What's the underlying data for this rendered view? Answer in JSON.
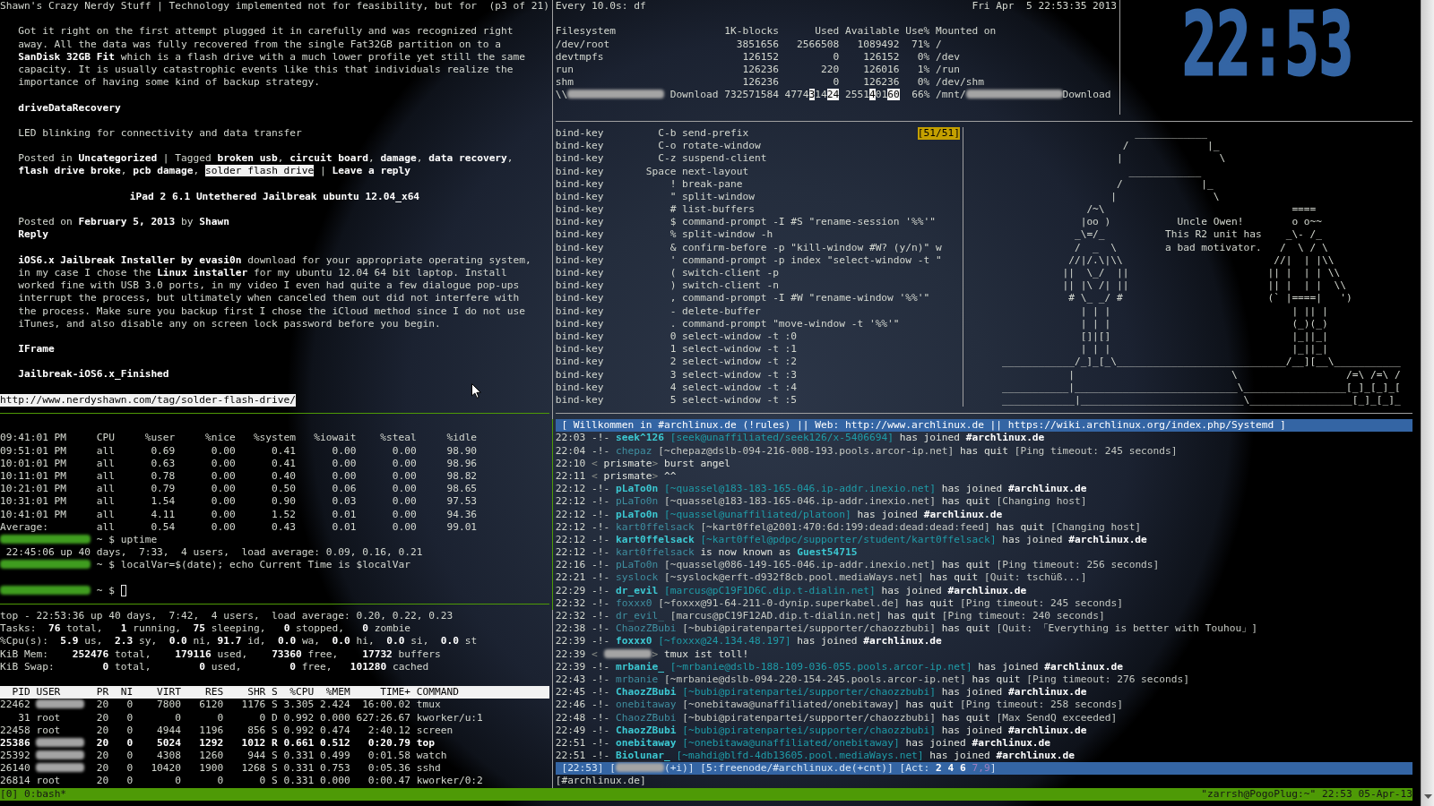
{
  "browser_pane": {
    "title": "Shawn's Crazy Nerdy Stuff | Technology implemented not for feasibility, but for",
    "page_indicator": "(p3 of 21)",
    "blocks": [
      {
        "kind": "paragraph",
        "lines": [
          "Got it right on the first attempt plugged it in carefully and was recognized right",
          "away. All the data was fully recovered from the single Fat32GB partition on to a",
          "**SanDisk 32GB Fit** which is a flash drive with a much lower profile yet still the same",
          "capacity. It is usually catastrophic events like this that individuals realize the",
          "importance of having some kind of backup strategy."
        ]
      },
      {
        "kind": "label",
        "lines": [
          "driveDataRecovery"
        ]
      },
      {
        "kind": "paragraph",
        "lines": [
          "LED blinking for connectivity and data transfer"
        ]
      },
      {
        "kind": "paragraph",
        "lines": [
          "Posted in **Uncategorized** | Tagged **broken usb**, **circuit board**, **damage**, **data recovery**,",
          [
            {
              "text": "**flash drive broke**, **pcb damage**, ",
              "kind": "text"
            },
            {
              "text": "solder flash drive",
              "kind": "link"
            },
            {
              "text": " | **Leave a reply**",
              "kind": "text"
            }
          ]
        ]
      },
      {
        "kind": "heading",
        "lines": [
          "iPad 2 6.1 Untethered Jailbreak ubuntu 12.04_x64"
        ]
      },
      {
        "kind": "paragraph",
        "lines": [
          "Posted on **February 5, 2013** by **Shawn**",
          [
            {
              "text": "Reply",
              "kind": "bold"
            }
          ]
        ]
      },
      {
        "kind": "paragraph",
        "lines": [
          "**iOS6.x Jailbreak Installer by evasi0n** download for your appropriate operating system,",
          "in my case I chose the **Linux installer** for my ubuntu 12.04 64 bit laptop. Install",
          "worked fine with USB 3.0 ports, in my video I even had quite a few dialogue pop-ups",
          "interrupt the process, but ultimately when canceled them out did not interfere with",
          "the process. Make sure you backup first I chose the iCloud method since I do not use",
          "iTunes, and also disable any on screen lock password before you begin."
        ]
      },
      {
        "kind": "label",
        "lines": [
          "IFrame"
        ]
      },
      {
        "kind": "label",
        "lines": [
          "Jailbreak-iOS6.x_Finished"
        ]
      }
    ],
    "status_url": "http://www.nerdyshawn.com/tag/solder-flash-drive/"
  },
  "watch_pane": {
    "command": "Every 10.0s: df",
    "timestamp": "Fri Apr  5 22:53:35 2013",
    "lines": [
      "Filesystem                  1K-blocks      Used Available Use% Mounted on",
      "/dev/root                     3851656   2566508   1089492  71% /",
      "devtmpfs                       126152         0    126152   0% /dev",
      "run                            126236       220    126016   1% /run",
      "shm                            126236         0    126236   0% /dev/shm",
      [
        {
          "text": "\\\\",
          "kind": "text"
        },
        {
          "kind": "redacted"
        },
        {
          "text": " Download 732571584 4774",
          "kind": "text"
        },
        {
          "text": "3",
          "kind": "changed"
        },
        {
          "text": "14",
          "kind": "text"
        },
        {
          "text": "24",
          "kind": "changed"
        },
        {
          "text": " 2551",
          "kind": "text"
        },
        {
          "text": "4",
          "kind": "changed"
        },
        {
          "text": "01",
          "kind": "text"
        },
        {
          "text": "60",
          "kind": "changed"
        },
        {
          "text": "  66% /mnt/",
          "kind": "text"
        },
        {
          "kind": "redacted"
        },
        {
          "text": "Download",
          "kind": "text"
        }
      ]
    ]
  },
  "clock_pane": {
    "time": "22:53"
  },
  "key_bindings_pane": {
    "position_indicator": "[51/51]",
    "lines": [
      "bind-key         C-b send-prefix",
      "bind-key         C-o rotate-window",
      "bind-key         C-z suspend-client",
      "bind-key       Space next-layout",
      "bind-key           ! break-pane",
      "bind-key           \" split-window",
      "bind-key           # list-buffers",
      "bind-key           $ command-prompt -I #S \"rename-session '%%'\"",
      "bind-key           % split-window -h",
      "bind-key           & confirm-before -p \"kill-window #W? (y/n)\" w",
      "bind-key           ' command-prompt -p index \"select-window -t \"",
      "bind-key           ( switch-client -p",
      "bind-key           ) switch-client -n",
      "bind-key           , command-prompt -I #W \"rename-window '%%'\"",
      "bind-key           - delete-buffer",
      "bind-key           . command-prompt \"move-window -t '%%'\"",
      "bind-key           0 select-window -t :0",
      "bind-key           1 select-window -t :1",
      "bind-key           2 select-window -t :2",
      "bind-key           3 select-window -t :3",
      "bind-key           4 select-window -t :4",
      "bind-key           5 select-window -t :5"
    ]
  },
  "ascii_art_pane": {
    "lines": [
      "                            ____________",
      "                          /             |_",
      "                         |                \\",
      "                           ____________",
      "                         /             |_",
      "                        |                \\",
      "                    /~\\                               ====",
      "                   |oo )           Uncle Owen!        o o~~",
      "                  _\\=/_          This R2 unit has    _\\- /_",
      "                  /  _  \\        a bad motivator.   /  \\ / \\",
      "                 //|/.\\|\\\\                         //|  | |\\\\",
      "                ||  \\_/  ||                       || |  | | \\\\",
      "                || |\\ /| ||                       || |  | |  \\\\",
      "                 # \\_ _/ #                        (` |====|   ')",
      "                   | | |                              | || |",
      "                   | | |                              (_)(_)",
      "                   []|[]                              |_||_|",
      "                   | | |                              |_||_|",
      "      ____________/_]_[_\\____________________________/__][__\\___________",
      "                 |                          \\                  /=\\ /=\\ /",
      "      ___________|___________________________\\_________________[_]_[_]_[",
      "      ____________|___________________________\\_________________[_]_[_]_"
    ]
  },
  "shell_pane": {
    "blocks": [
      {
        "lines": [
          "09:41:01 PM     CPU     %user     %nice   %system   %iowait    %steal     %idle",
          "09:51:01 PM     all      0.69      0.00      0.41      0.00      0.00     98.90",
          "10:01:01 PM     all      0.63      0.00      0.41      0.00      0.00     98.96",
          "10:11:01 PM     all      0.78      0.00      0.40      0.00      0.00     98.82",
          "10:21:01 PM     all      0.79      0.00      0.50      0.06      0.00     98.65",
          "10:31:01 PM     all      1.54      0.00      0.90      0.03      0.00     97.53",
          "10:41:01 PM     all      4.11      0.00      1.52      0.01      0.00     94.36",
          "Average:        all      0.54      0.00      0.43      0.01      0.00     99.01",
          [
            {
              "kind": "redacted-prompt"
            },
            {
              "text": " ~ $ uptime",
              "kind": "text"
            }
          ],
          " 22:45:06 up 40 days,  7:33,  4 users,  load average: 0.09, 0.16, 0.21",
          [
            {
              "kind": "redacted-prompt"
            },
            {
              "text": " ~ $ localVar=$(date); echo Current Time is $localVar",
              "kind": "text"
            }
          ]
        ]
      },
      {
        "lines": [
          [
            {
              "kind": "redacted-prompt"
            },
            {
              "text": " ~ $ ",
              "kind": "text"
            },
            {
              "kind": "cursor"
            }
          ]
        ]
      }
    ]
  },
  "top_pane": {
    "summary": [
      "top - 22:53:36 up 40 days,  7:42,  4 users,  load average: 0.20, 0.22, 0.23",
      "Tasks:  **76** total,   **1** running,  **75** sleeping,   **0** stopped,   **0** zombie",
      "%Cpu(s):  **5.9** us,  **2.3** sy,  **0.0** ni, **91.7** id,  **0.0** wa,  **0.0** hi,  **0.0** si,  **0.0** st",
      "KiB Mem:    **252476** total,    **179116** used,    **73360** free,    **17732** buffers",
      "KiB Swap:        **0** total,        **0** used,        **0** free,   **101280** cached"
    ],
    "process_table": {
      "header": "  PID USER      PR  NI    VIRT    RES    SHR S  %CPU  %MEM     TIME+ COMMAND",
      "rows": [
        {
          "highlighted": false,
          "segments": [
            {
              "text": "22462 ",
              "kind": "text"
            },
            {
              "kind": "redacted"
            },
            {
              "text": "  20   0    7800   6120   1176 S 3.305 2.424  16:00.02 tmux",
              "kind": "text"
            }
          ]
        },
        {
          "highlighted": false,
          "segments": [
            {
              "text": "   31 root      20   0       0      0      0 D 0.992 0.000 627:26.67 kworker/u:1",
              "kind": "text"
            }
          ]
        },
        {
          "highlighted": false,
          "segments": [
            {
              "text": "22458 root      20   0    4944   1196    856 S 0.992 0.474   2:40.12 screen",
              "kind": "text"
            }
          ]
        },
        {
          "highlighted": true,
          "segments": [
            {
              "text": "25386 ",
              "kind": "text"
            },
            {
              "kind": "redacted"
            },
            {
              "text": "  20   0    5024   1292   1012 R 0.661 0.512   0:20.79 top",
              "kind": "text"
            }
          ]
        },
        {
          "highlighted": false,
          "segments": [
            {
              "text": "25392 ",
              "kind": "text"
            },
            {
              "kind": "redacted"
            },
            {
              "text": "  20   0    4308   1260    944 S 0.331 0.499   0:01.58 watch",
              "kind": "text"
            }
          ]
        },
        {
          "highlighted": false,
          "segments": [
            {
              "text": "26140 ",
              "kind": "text"
            },
            {
              "kind": "redacted"
            },
            {
              "text": "  20   0   10420   1900   1268 S 0.331 0.753   0:05.36 sshd",
              "kind": "text"
            }
          ]
        },
        {
          "highlighted": false,
          "segments": [
            {
              "text": "26814 root      20   0       0      0      0 S 0.331 0.000   0:00.47 kworker/0:2",
              "kind": "text"
            }
          ]
        }
      ]
    }
  },
  "irc_pane": {
    "topic": "[ Willkommen in #archlinux.de (!rules) || Web: http://www.archlinux.de || https://wiki.archlinux.org/index.php/Systemd ]",
    "messages": [
      {
        "time": "22:03",
        "kind": "join",
        "marker": "-!-",
        "nick": "seek^126",
        "host": "[seek@unaffiliated/seek126/x-5406694]",
        "action": "has joined",
        "target": "#archlinux.de"
      },
      {
        "time": "22:04",
        "kind": "quit",
        "marker": "-!-",
        "nick": "chepaz",
        "host": "[~chepaz@dslb-094-216-008-193.pools.arcor-ip.net]",
        "action": "has quit",
        "reason": "[Ping timeout: 245 seconds]"
      },
      {
        "time": "22:10",
        "kind": "message",
        "nick_open": "<",
        "redacted": false,
        "nick": "prismate",
        "nick_close": ">",
        "text": "burst angel"
      },
      {
        "time": "22:11",
        "kind": "message",
        "nick_open": "<",
        "redacted": false,
        "nick": "prismate",
        "nick_close": ">",
        "text": "^^"
      },
      {
        "time": "22:12",
        "kind": "join",
        "marker": "-!-",
        "nick": "pLaTo0n",
        "host": "[~quassel@183-183-165-046.ip-addr.inexio.net]",
        "action": "has joined",
        "target": "#archlinux.de"
      },
      {
        "time": "22:12",
        "kind": "quit",
        "marker": "-!-",
        "nick": "pLaTo0n",
        "host": "[~quassel@183-183-165-046.ip-addr.inexio.net]",
        "action": "has quit",
        "reason": "[Changing host]"
      },
      {
        "time": "22:12",
        "kind": "join",
        "marker": "-!-",
        "nick": "pLaTo0n",
        "host": "[~quassel@unaffiliated/platoon]",
        "action": "has joined",
        "target": "#archlinux.de"
      },
      {
        "time": "22:12",
        "kind": "quit",
        "marker": "-!-",
        "nick": "kart0ffelsack",
        "host": "[~kart0ffel@2001:470:6d:199:dead:dead:dead:feed]",
        "action": "has quit",
        "reason": "[Changing host]"
      },
      {
        "time": "22:12",
        "kind": "join",
        "marker": "-!-",
        "nick": "kart0ffelsack",
        "host": "[~kart0ffel@pdpc/supporter/student/kart0ffelsack]",
        "action": "has joined",
        "target": "#archlinux.de"
      },
      {
        "time": "22:12",
        "kind": "nick",
        "marker": "-!-",
        "nick": "kart0ffelsack",
        "action": "is now known as",
        "target": "Guest54715"
      },
      {
        "time": "22:16",
        "kind": "quit",
        "marker": "-!-",
        "nick": "pLaTo0n",
        "host": "[~quassel@086-149-165-046.ip-addr.inexio.net]",
        "action": "has quit",
        "reason": "[Ping timeout: 256 seconds]"
      },
      {
        "time": "22:21",
        "kind": "quit",
        "marker": "-!-",
        "nick": "syslock",
        "host": "[~syslock@erft-d932f8cb.pool.mediaWays.net]",
        "action": "has quit",
        "reason": "[Quit: tschüß...]"
      },
      {
        "time": "22:29",
        "kind": "join",
        "marker": "-!-",
        "nick": "dr_evil",
        "host": "[marcus@pC19F1D6C.dip.t-dialin.net]",
        "action": "has joined",
        "target": "#archlinux.de"
      },
      {
        "time": "22:32",
        "kind": "quit",
        "marker": "-!-",
        "nick": "foxxx0",
        "host": "[~foxxx@91-64-211-0-dynip.superkabel.de]",
        "action": "has quit",
        "reason": "[Ping timeout: 245 seconds]"
      },
      {
        "time": "22:32",
        "kind": "quit",
        "marker": "-!-",
        "nick": "dr_evil_",
        "host": "[marcus@pC19F12AD.dip.t-dialin.net]",
        "action": "has quit",
        "reason": "[Ping timeout: 240 seconds]"
      },
      {
        "time": "22:38",
        "kind": "quit",
        "marker": "-!-",
        "nick": "ChaozZBubi",
        "host": "[~bubi@piratenpartei/supporter/chaozzbubi]",
        "action": "has quit",
        "reason": "[Quit: 「Everything is better with Touhou」]"
      },
      {
        "time": "22:39",
        "kind": "join",
        "marker": "-!-",
        "nick": "foxxx0",
        "host": "[~foxxx@24.134.48.197]",
        "action": "has joined",
        "target": "#archlinux.de"
      },
      {
        "time": "22:39",
        "kind": "message",
        "nick_open": "<",
        "redacted": true,
        "nick_close": ">",
        "text": "tmux ist toll!"
      },
      {
        "time": "22:39",
        "kind": "join",
        "marker": "-!-",
        "nick": "mrbanie_",
        "host": "[~mrbanie@dslb-188-109-036-055.pools.arcor-ip.net]",
        "action": "has joined",
        "target": "#archlinux.de"
      },
      {
        "time": "22:43",
        "kind": "quit",
        "marker": "-!-",
        "nick": "mrbanie",
        "host": "[~mrbanie@dslb-094-220-154-245.pools.arcor-ip.net]",
        "action": "has quit",
        "reason": "[Ping timeout: 276 seconds]"
      },
      {
        "time": "22:45",
        "kind": "join",
        "marker": "-!-",
        "nick": "ChaozZBubi",
        "host": "[~bubi@piratenpartei/supporter/chaozzbubi]",
        "action": "has joined",
        "target": "#archlinux.de"
      },
      {
        "time": "22:46",
        "kind": "quit",
        "marker": "-!-",
        "nick": "onebitaway",
        "host": "[~onebitawa@unaffiliated/onebitaway]",
        "action": "has quit",
        "reason": "[Ping timeout: 258 seconds]"
      },
      {
        "time": "22:48",
        "kind": "quit",
        "marker": "-!-",
        "nick": "ChaozZBubi",
        "host": "[~bubi@piratenpartei/supporter/chaozzbubi]",
        "action": "has quit",
        "reason": "[Max SendQ exceeded]"
      },
      {
        "time": "22:49",
        "kind": "join",
        "marker": "-!-",
        "nick": "ChaozZBubi",
        "host": "[~bubi@piratenpartei/supporter/chaozzbubi]",
        "action": "has joined",
        "target": "#archlinux.de"
      },
      {
        "time": "22:51",
        "kind": "join",
        "marker": "-!-",
        "nick": "onebitaway",
        "host": "[~onebitawa@unaffiliated/onebitaway]",
        "action": "has joined",
        "target": "#archlinux.de"
      },
      {
        "time": "22:51",
        "kind": "join",
        "marker": "-!-",
        "nick": "Biolunar_",
        "host": "[~mahdi@blfd-4db13605.pool.mediaWays.net]",
        "action": "has joined",
        "target": "#archlinux.de"
      }
    ],
    "status_bar": [
      {
        "text": "[22:53] [",
        "kind": "text"
      },
      {
        "kind": "redacted"
      },
      {
        "text": "(+i)] [5:freenode/#archlinux.de(+cnt)] [Act: **2 4 6** ",
        "kind": "text"
      },
      {
        "text": "7,9",
        "kind": "dim"
      },
      {
        "text": "]",
        "kind": "text"
      }
    ],
    "input_prompt": "[#archlinux.de]"
  },
  "tmux_status_bar": {
    "session": "[0]",
    "window": "0:bash*",
    "status_right": "\"zarrsh@PogoPlug:~\" 22:53 05-Apr-13"
  }
}
